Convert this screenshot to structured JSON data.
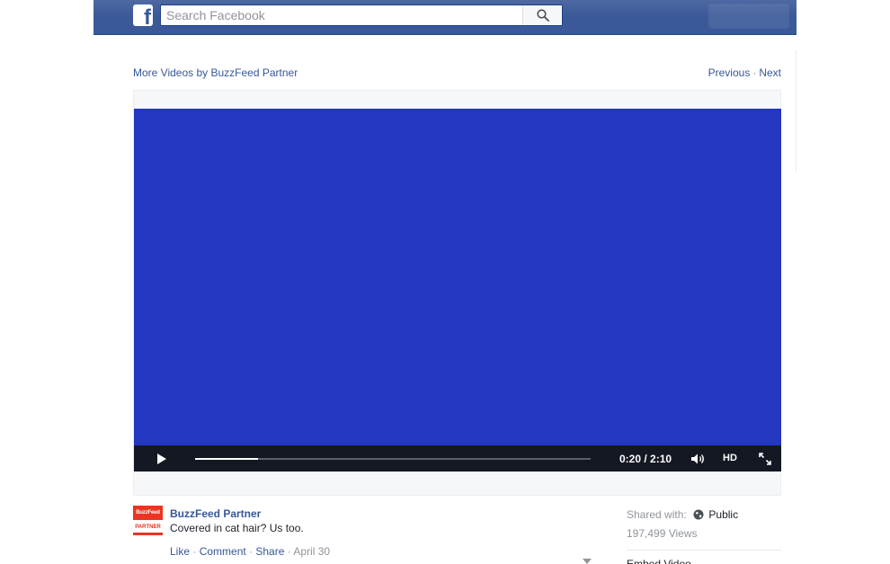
{
  "header": {
    "search_placeholder": "Search Facebook",
    "logo_letter": "f"
  },
  "nav": {
    "more_videos": "More Videos by BuzzFeed Partner",
    "previous": "Previous",
    "separator": "·",
    "next": "Next"
  },
  "video": {
    "background_color": "#2337c1",
    "current_time": "0:20",
    "duration": "2:10",
    "time_display": "0:20 / 2:10",
    "progress_fraction": 0.16,
    "hd_label": "HD"
  },
  "post": {
    "avatar_top_text": "BuzzFeed",
    "avatar_bottom_text": "PARTNER",
    "page_name": "BuzzFeed Partner",
    "text": "Covered in cat hair? Us too.",
    "like": "Like",
    "comment": "Comment",
    "share": "Share",
    "date": "April 30",
    "sep": " · "
  },
  "sidebar": {
    "shared_with_label": "Shared with:",
    "privacy": "Public",
    "views": "197,499 Views",
    "embed_label": "Embed Video"
  },
  "colors": {
    "brand_blue": "#3b5998",
    "link_blue": "#365899",
    "buzzfeed_red": "#ee3322"
  }
}
